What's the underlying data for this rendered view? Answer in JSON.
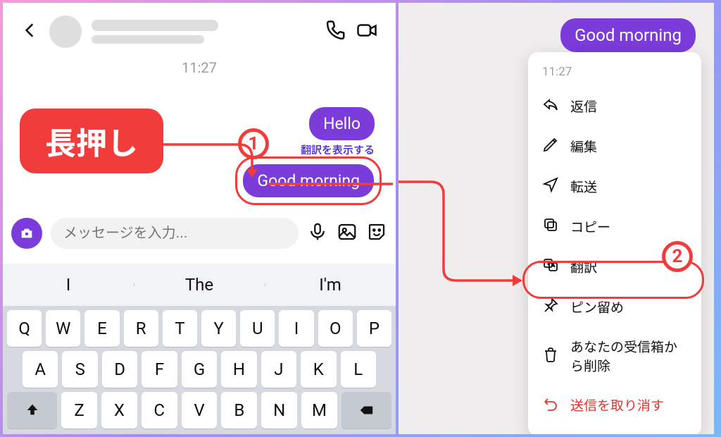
{
  "left": {
    "timestamp": "11:27",
    "messages": {
      "first": "Hello",
      "second": "Good morning"
    },
    "translate_hint": "翻訳を表示する",
    "longpress_label": "長押し",
    "input_placeholder": "メッセージを入力...",
    "suggestions": [
      "I",
      "The",
      "I'm"
    ],
    "keyboard": {
      "row1": [
        "Q",
        "W",
        "E",
        "R",
        "T",
        "Y",
        "U",
        "I",
        "O",
        "P"
      ],
      "row2": [
        "A",
        "S",
        "D",
        "F",
        "G",
        "H",
        "J",
        "K",
        "L"
      ],
      "row3": [
        "Z",
        "X",
        "C",
        "V",
        "B",
        "N",
        "M"
      ]
    }
  },
  "right": {
    "message": "Good morning",
    "menu_time": "11:27",
    "menu": {
      "reply": "返信",
      "edit": "編集",
      "forward": "転送",
      "copy": "コピー",
      "translate": "翻訳",
      "pin": "ピン留め",
      "delete_inbox": "あなたの受信箱から削除",
      "unsend": "送信を取り消す"
    }
  },
  "badges": {
    "one": "1",
    "two": "2"
  }
}
